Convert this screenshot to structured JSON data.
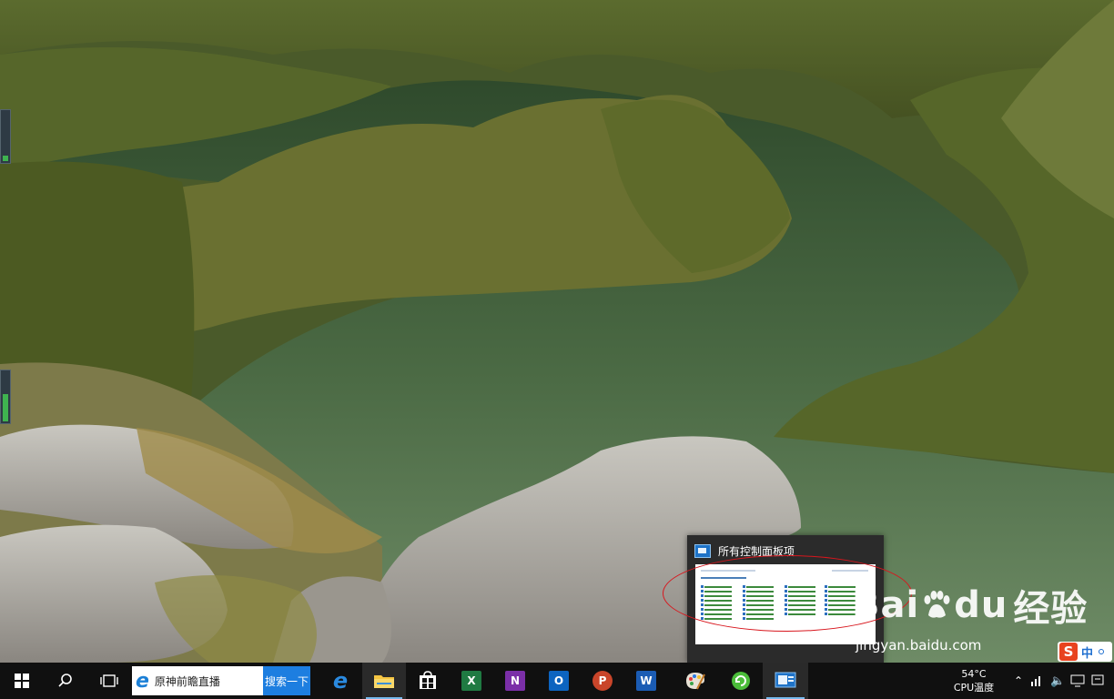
{
  "preview": {
    "title": "所有控制面板项"
  },
  "watermark": {
    "brand_left": "Bai",
    "brand_right": "du",
    "brand_cn": "经验",
    "url": "jingyan.baidu.com"
  },
  "taskbar": {
    "search_placeholder": "原神前瞻直播",
    "search_button": "搜索一下",
    "apps": [
      {
        "name": "edge",
        "label": "e"
      },
      {
        "name": "file-explorer",
        "label": ""
      },
      {
        "name": "microsoft-store",
        "label": ""
      },
      {
        "name": "excel",
        "label": "X"
      },
      {
        "name": "onenote",
        "label": "N"
      },
      {
        "name": "outlook",
        "label": "O"
      },
      {
        "name": "powerpoint",
        "label": "P"
      },
      {
        "name": "word",
        "label": "W"
      },
      {
        "name": "paint",
        "label": ""
      },
      {
        "name": "green-app",
        "label": ""
      },
      {
        "name": "control-panel",
        "label": ""
      }
    ],
    "temperature": "54°C",
    "temperature_label": "CPU温度",
    "ime_label": "中"
  },
  "colors": {
    "taskbar_bg": "#101010",
    "accent_blue": "#1d7ee0",
    "annotation_red": "#d8161d"
  }
}
